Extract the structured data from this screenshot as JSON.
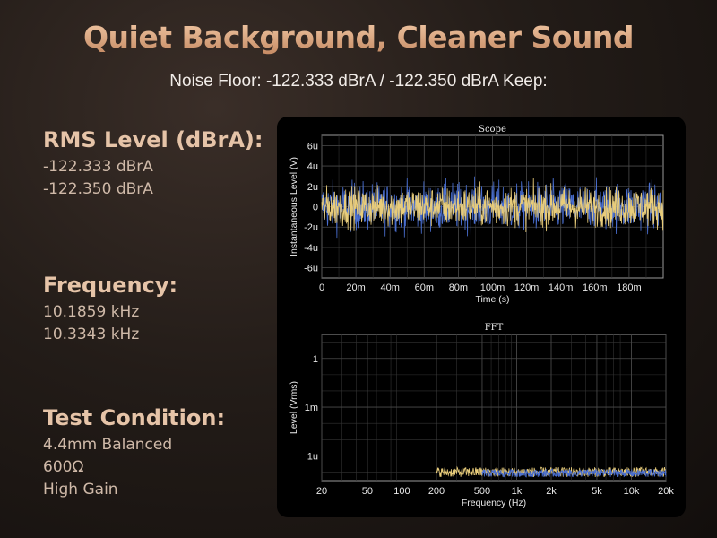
{
  "header": {
    "title": "Quiet Background, Cleaner Sound",
    "subtitle": "Noise Floor: -122.333 dBrA / -122.350 dBrA Keep:"
  },
  "specs": {
    "rms": {
      "label": "RMS Level (dBrA):",
      "values": [
        "-122.333 dBrA",
        "-122.350 dBrA"
      ]
    },
    "frequency": {
      "label": "Frequency:",
      "values": [
        "10.1859 kHz",
        "10.3343 kHz"
      ]
    },
    "test": {
      "label": "Test Condition:",
      "values": [
        "4.4mm Balanced",
        "600Ω",
        "High Gain"
      ]
    }
  },
  "colors": {
    "series_yellow": "#e8cc7a",
    "series_blue": "#4a6fd0",
    "grid": "#4a4a4a",
    "accent": "#e0b38f"
  },
  "chart_data": [
    {
      "type": "line",
      "title": "Scope",
      "xlabel": "Time (s)",
      "ylabel": "Instantaneous Level (V)",
      "xlim": [
        0,
        0.2
      ],
      "ylim": [
        -7,
        7
      ],
      "x_ticks": [
        {
          "value": 0,
          "label": "0"
        },
        {
          "value": 0.02,
          "label": "20m"
        },
        {
          "value": 0.04,
          "label": "40m"
        },
        {
          "value": 0.06,
          "label": "60m"
        },
        {
          "value": 0.08,
          "label": "80m"
        },
        {
          "value": 0.1,
          "label": "100m"
        },
        {
          "value": 0.12,
          "label": "120m"
        },
        {
          "value": 0.14,
          "label": "140m"
        },
        {
          "value": 0.16,
          "label": "160m"
        },
        {
          "value": 0.18,
          "label": "180m"
        }
      ],
      "y_ticks": [
        {
          "value": 6,
          "label": "6u"
        },
        {
          "value": 4,
          "label": "4u"
        },
        {
          "value": 2,
          "label": "2u"
        },
        {
          "value": 0,
          "label": "0"
        },
        {
          "value": -2,
          "label": "-2u"
        },
        {
          "value": -4,
          "label": "-4u"
        },
        {
          "value": -6,
          "label": "-6u"
        }
      ],
      "series": [
        {
          "color": "#4a6fd0",
          "noise_amplitude": 2.3
        },
        {
          "color": "#e8cc7a",
          "noise_amplitude": 1.9
        }
      ],
      "grid": true
    },
    {
      "type": "line",
      "title": "FFT",
      "xlabel": "Frequency (Hz)",
      "ylabel": "Level (Vrms)",
      "x_scale": "log",
      "y_scale": "log",
      "xlim": [
        20,
        20000
      ],
      "ylim": [
        3e-08,
        30
      ],
      "x_ticks": [
        {
          "value": 20,
          "label": "20"
        },
        {
          "value": 50,
          "label": "50"
        },
        {
          "value": 100,
          "label": "100"
        },
        {
          "value": 200,
          "label": "200"
        },
        {
          "value": 500,
          "label": "500"
        },
        {
          "value": 1000,
          "label": "1k"
        },
        {
          "value": 2000,
          "label": "2k"
        },
        {
          "value": 5000,
          "label": "5k"
        },
        {
          "value": 10000,
          "label": "10k"
        },
        {
          "value": 20000,
          "label": "20k"
        }
      ],
      "y_ticks": [
        {
          "value": 1,
          "label": "1"
        },
        {
          "value": 0.001,
          "label": "1m"
        },
        {
          "value": 1e-06,
          "label": "1u"
        }
      ],
      "series": [
        {
          "color": "#e8cc7a",
          "level_range": [
            5e-08,
            2e-07
          ],
          "x_start": 200
        },
        {
          "color": "#4a6fd0",
          "level_range": [
            5e-08,
            1.5e-07
          ],
          "x_start": 500
        }
      ],
      "grid": true
    }
  ]
}
